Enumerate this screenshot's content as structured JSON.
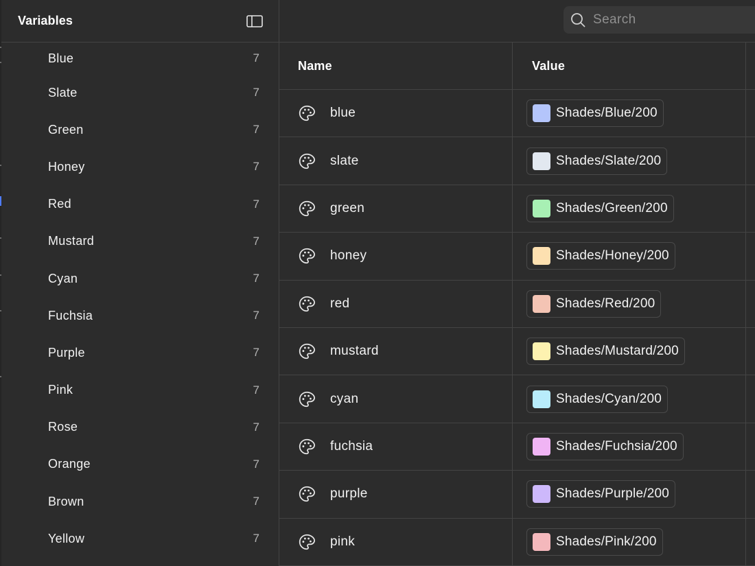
{
  "sidebar": {
    "title": "Variables",
    "collections": [
      {
        "label": "Blue",
        "count": "7"
      },
      {
        "label": "Slate",
        "count": "7"
      },
      {
        "label": "Green",
        "count": "7"
      },
      {
        "label": "Honey",
        "count": "7"
      },
      {
        "label": "Red",
        "count": "7"
      },
      {
        "label": "Mustard",
        "count": "7"
      },
      {
        "label": "Cyan",
        "count": "7"
      },
      {
        "label": "Fuchsia",
        "count": "7"
      },
      {
        "label": "Purple",
        "count": "7"
      },
      {
        "label": "Pink",
        "count": "7"
      },
      {
        "label": "Rose",
        "count": "7"
      },
      {
        "label": "Orange",
        "count": "7"
      },
      {
        "label": "Brown",
        "count": "7"
      },
      {
        "label": "Yellow",
        "count": "7"
      }
    ]
  },
  "search": {
    "placeholder": "Search",
    "value": ""
  },
  "table": {
    "headers": {
      "name": "Name",
      "value": "Value"
    },
    "rows": [
      {
        "name": "blue",
        "value": "Shades/Blue/200",
        "swatch": "#b4c5fb"
      },
      {
        "name": "slate",
        "value": "Shades/Slate/200",
        "swatch": "#e2e8f0"
      },
      {
        "name": "green",
        "value": "Shades/Green/200",
        "swatch": "#a8f0b4"
      },
      {
        "name": "honey",
        "value": "Shades/Honey/200",
        "swatch": "#fde0b0"
      },
      {
        "name": "red",
        "value": "Shades/Red/200",
        "swatch": "#f4c4b4"
      },
      {
        "name": "mustard",
        "value": "Shades/Mustard/200",
        "swatch": "#fdf2b0"
      },
      {
        "name": "cyan",
        "value": "Shades/Cyan/200",
        "swatch": "#b8ecfb"
      },
      {
        "name": "fuchsia",
        "value": "Shades/Fuchsia/200",
        "swatch": "#f0b4f4"
      },
      {
        "name": "purple",
        "value": "Shades/Purple/200",
        "swatch": "#cdb8fb"
      },
      {
        "name": "pink",
        "value": "Shades/Pink/200",
        "swatch": "#f4b8bc"
      }
    ]
  },
  "icons": {
    "panel_toggle": "sidebar-panel-icon",
    "search": "search-icon",
    "variable_type": "palette-icon"
  }
}
